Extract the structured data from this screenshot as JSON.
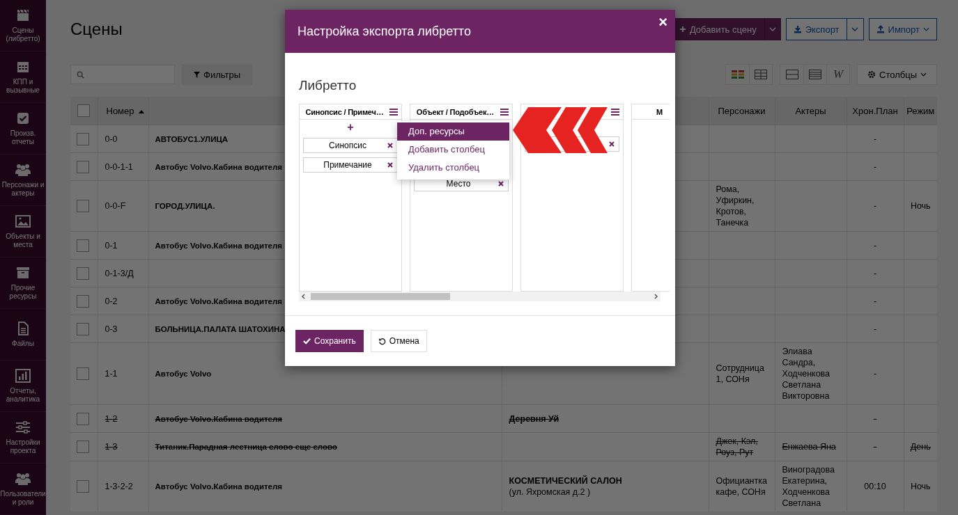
{
  "sidebar": {
    "items": [
      {
        "label": "Сцены (либретто)"
      },
      {
        "label": "КПП и вызывные"
      },
      {
        "label": "Произв. отчеты"
      },
      {
        "label": "Персонажи и актеры"
      },
      {
        "label": "Объекты и места"
      },
      {
        "label": "Прочие ресурсы"
      },
      {
        "label": "Файлы"
      },
      {
        "label": "Отчеты, аналитика"
      },
      {
        "label": "Настройки проекта"
      },
      {
        "label": "Пользователи и роли"
      }
    ]
  },
  "page": {
    "title": "Сцены",
    "add_scene": "Добавить сцену",
    "export": "Экспорт",
    "import": "Импорт"
  },
  "toolbar": {
    "filters": "Фильтры",
    "view_glyph": "W",
    "columns_button": "Столбцы"
  },
  "table": {
    "columns": [
      {
        "kind": "check",
        "checked": false
      },
      {
        "kind": "text",
        "label": "Номер",
        "sorted": true
      },
      {
        "kind": "blank"
      },
      {
        "kind": "blank"
      },
      {
        "kind": "text",
        "label": "Персонажи"
      },
      {
        "kind": "text",
        "label": "Актеры"
      },
      {
        "kind": "text",
        "label": "Хрон.План"
      },
      {
        "kind": "text",
        "label": "Режим"
      }
    ],
    "rows": [
      {
        "checked": false,
        "deleted": false,
        "number": "0-0",
        "title": "АВТОБУС1.УЛИЦА",
        "chron": "-"
      },
      {
        "checked": false,
        "deleted": false,
        "number": "0-0-1-1",
        "title": "Автобус Volvo.Кабина водителя",
        "chron": "-"
      },
      {
        "checked": false,
        "deleted": false,
        "number": "0-0-F",
        "title": "ГОРОД.УЛИЦА.",
        "characters": "Рома, Уфиркин, Кротов, Танечка",
        "chron": "-",
        "mode": "Ночь"
      },
      {
        "checked": false,
        "deleted": false,
        "number": "0-1",
        "title": "Автобус Volvo.Кабина водителя",
        "chron": "-"
      },
      {
        "checked": false,
        "deleted": false,
        "number": "0-1-3/Д",
        "chron": "-"
      },
      {
        "checked": false,
        "deleted": false,
        "number": "0-2",
        "title": "Автобус Volvo.Кабина водителя",
        "chron": "-"
      },
      {
        "checked": false,
        "deleted": false,
        "number": "0-3",
        "title": "БОЛЬНИЦА.ПАЛАТА ШАТОХИНА",
        "chron": "-"
      },
      {
        "checked": false,
        "deleted": false,
        "number": "1-1",
        "title": "Автобус Volvo",
        "characters": "Сотрудница 1, СОНя",
        "actors": "Элиава Сандра, Ходченкова Светлана Викторовна",
        "chron": "-"
      },
      {
        "checked": false,
        "deleted": true,
        "number": "1-2",
        "title": "Автобус Volvo.Кабина водителя",
        "location": {
          "name": "Деревня Уй"
        },
        "chron": "-"
      },
      {
        "checked": false,
        "deleted": true,
        "number": "1-3",
        "title": "Титаник.Парадная лестница слово еще слово",
        "characters": "Джек, Кэл, Роуз, Рут",
        "actors": "Енжаева Яна",
        "chron": "-",
        "mode": "День"
      },
      {
        "checked": false,
        "deleted": false,
        "number": "1-3-2-2",
        "title": "Автобус Volvo.Кабина водителя",
        "location": {
          "name": "КОСМЕТИЧЕСКИЙ САЛОН",
          "address": "(ул. Яхромская д.2 )"
        },
        "characters": "Официантка кафе, СОНя",
        "actors": "Виноградова Екатерина, Ходченкова Светлана",
        "chron": "00:10",
        "mode": "Ночь"
      }
    ]
  },
  "modal": {
    "title": "Настройка экспорта либретто",
    "close": "×",
    "heading": "Либретто",
    "columns": [
      {
        "title": "Синопсис / Примеч…",
        "add": "+",
        "chips": [
          {
            "kind": "field",
            "label": "Синопсис"
          },
          {
            "kind": "field",
            "label": "Примечание"
          }
        ]
      },
      {
        "title": "Объект / Подобъек…",
        "chips": [
          {
            "kind": "field",
            "label": "Место"
          }
        ]
      },
      {
        "chips": [
          {
            "kind": "field"
          }
        ]
      },
      {
        "title": "М"
      }
    ],
    "menu": [
      {
        "label": "Доп. ресурсы",
        "selected": true
      },
      {
        "label": "Добавить столбец",
        "selected": false
      },
      {
        "label": "Удалить столбец",
        "selected": false
      }
    ],
    "save": "Сохранить",
    "cancel": "Отмена"
  }
}
